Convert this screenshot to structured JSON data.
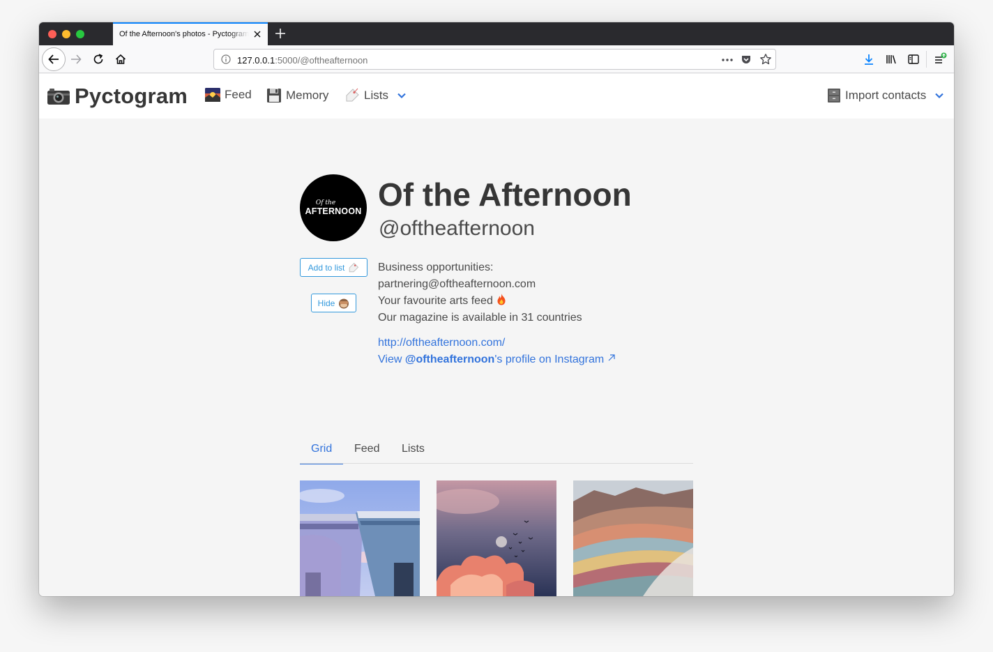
{
  "browser": {
    "tab_title": "Of the Afternoon's photos - Pyctogram",
    "url_host": "127.0.0.1",
    "url_path": ":5000/@oftheafternoon"
  },
  "app": {
    "brand": "Pyctogram",
    "nav": {
      "feed": "Feed",
      "memory": "Memory",
      "lists": "Lists",
      "import_contacts": "Import contacts"
    }
  },
  "profile": {
    "avatar_small": "Of the",
    "avatar_big": "AFTERNOON",
    "name": "Of the Afternoon",
    "handle": "@oftheafternoon",
    "add_to_list": "Add to list",
    "hide": "Hide",
    "bio": [
      "Business opportunities:",
      "partnering@oftheafternoon.com",
      "Your favourite arts feed",
      "Our magazine is available in 31 countries"
    ],
    "website": "http://oftheafternoon.com/",
    "instagram_prefix": "View ",
    "instagram_handle": "@oftheafternoon",
    "instagram_suffix": "'s profile on Instagram"
  },
  "tabs": {
    "grid": "Grid",
    "feed": "Feed",
    "lists": "Lists"
  },
  "grid_images": [
    "houses-sky-photo",
    "clouds-birds-photo",
    "rainbow-mountains-photo"
  ],
  "colors": {
    "link": "#3273dc",
    "button": "#3298dc",
    "tab_accent": "#0a84ff"
  }
}
